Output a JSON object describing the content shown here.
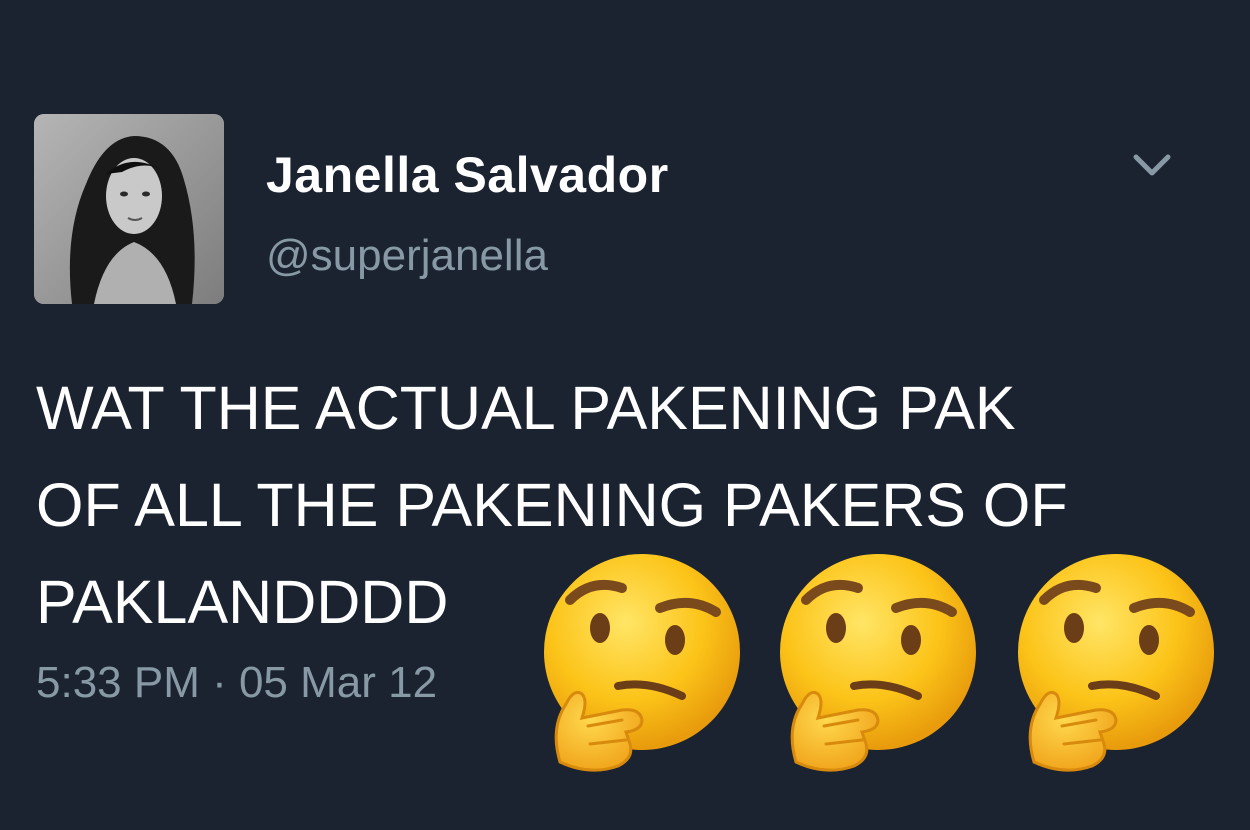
{
  "tweet": {
    "display_name": "Janella Salvador",
    "handle": "@superjanella",
    "text_lines": [
      "WAT THE ACTUAL PAKENING PAK",
      "OF ALL THE PAKENING PAKERS OF",
      "PAKLANDDDD"
    ],
    "timestamp": "5:33 PM · 05 Mar 12",
    "menu_icon": "chevron-down-icon"
  },
  "decorations": {
    "emoji": [
      "thinking-face-emoji",
      "thinking-face-emoji",
      "thinking-face-emoji"
    ]
  },
  "colors": {
    "background": "#1b2330",
    "primary_text": "#ffffff",
    "secondary_text": "#8899a6"
  }
}
